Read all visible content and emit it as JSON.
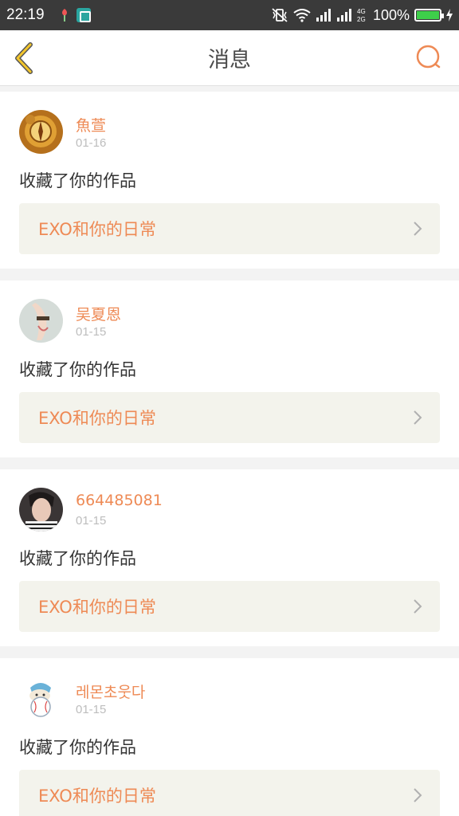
{
  "status_bar": {
    "time": "22:19",
    "network_badge": "4G\n2G",
    "battery": "100%",
    "battery_level": 1.0
  },
  "header": {
    "title": "消息"
  },
  "messages": [
    {
      "username": "魚萱",
      "date": "01-16",
      "action": "收藏了你的作品",
      "work_title": "EXO和你的日常"
    },
    {
      "username": "吴夏恩",
      "date": "01-15",
      "action": "收藏了你的作品",
      "work_title": "EXO和你的日常"
    },
    {
      "username": "664485081",
      "date": "01-15",
      "action": "收藏了你的作品",
      "work_title": "EXO和你的日常"
    },
    {
      "username": "레몬초웃다",
      "date": "01-15",
      "action": "收藏了你的作品",
      "work_title": "EXO和你的日常"
    }
  ],
  "colors": {
    "accent": "#ee8a55",
    "back_icon": "#f2c52c",
    "status_bar_bg": "#3a3a3a",
    "card_link_bg": "#f3f3ec"
  },
  "icons": {
    "back": "chevron-left-icon",
    "search": "search-icon",
    "row_arrow": "chevron-right-icon"
  }
}
